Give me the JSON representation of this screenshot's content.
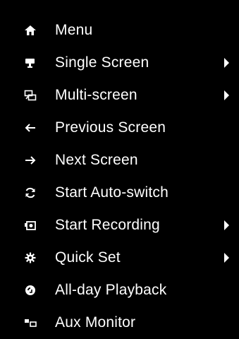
{
  "menu": {
    "items": [
      {
        "label": "Menu",
        "icon": "home-icon",
        "has_submenu": false
      },
      {
        "label": "Single Screen",
        "icon": "single-screen-icon",
        "has_submenu": true
      },
      {
        "label": "Multi-screen",
        "icon": "multi-screen-icon",
        "has_submenu": true
      },
      {
        "label": "Previous Screen",
        "icon": "arrow-left-icon",
        "has_submenu": false
      },
      {
        "label": "Next Screen",
        "icon": "arrow-right-icon",
        "has_submenu": false
      },
      {
        "label": "Start Auto-switch",
        "icon": "auto-switch-icon",
        "has_submenu": false
      },
      {
        "label": "Start Recording",
        "icon": "recording-icon",
        "has_submenu": true
      },
      {
        "label": "Quick Set",
        "icon": "gear-icon",
        "has_submenu": true
      },
      {
        "label": "All-day Playback",
        "icon": "playback-icon",
        "has_submenu": false
      },
      {
        "label": "Aux Monitor",
        "icon": "aux-monitor-icon",
        "has_submenu": false
      }
    ]
  },
  "colors": {
    "background": "#000000",
    "text": "#ffffff"
  }
}
